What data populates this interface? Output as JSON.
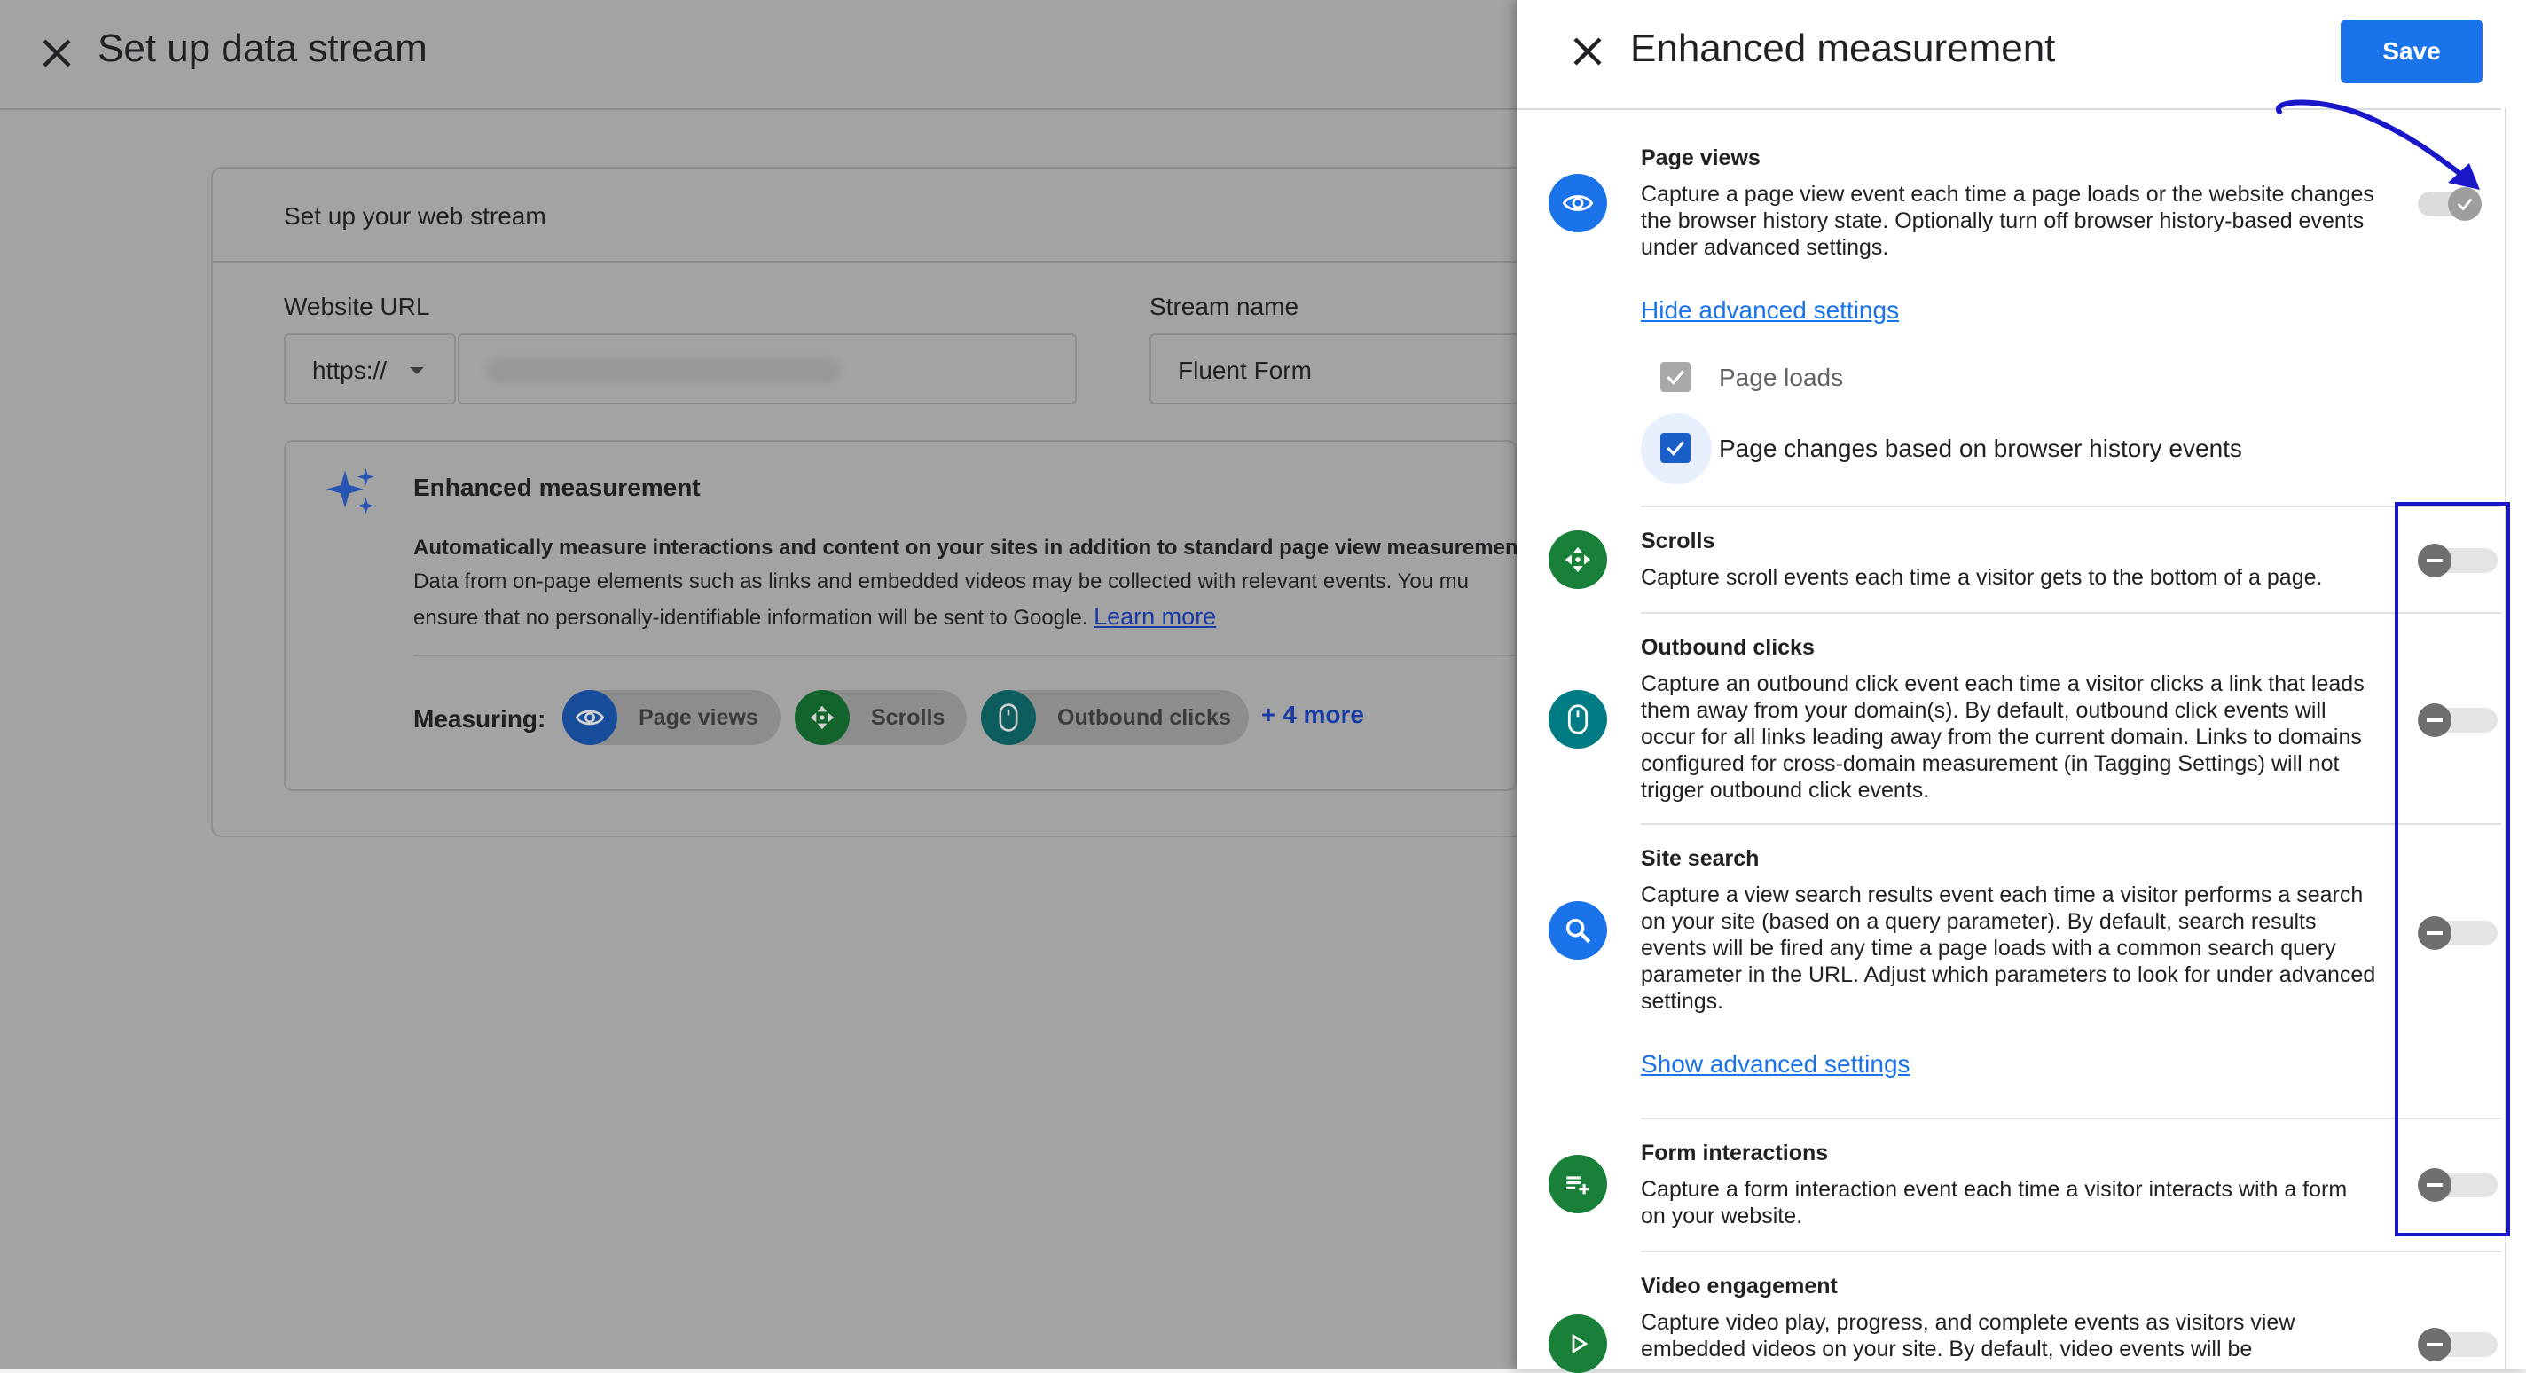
{
  "left": {
    "title": "Set up data stream",
    "card_title": "Set up your web stream",
    "website_url_label": "Website URL",
    "protocol_value": "https://",
    "stream_name_label": "Stream name",
    "stream_name_value": "Fluent Form",
    "enhanced": {
      "title": "Enhanced measurement",
      "desc_bold": "Automatically measure interactions and content on your sites in addition to standard page view measurement.",
      "desc_line2": "Data from on-page elements such as links and embedded videos may be collected with relevant events. You mu",
      "desc_line3": "ensure that no personally-identifiable information will be sent to Google.",
      "learn_more": "Learn more",
      "measuring_label": "Measuring:",
      "chips": [
        "Page views",
        "Scrolls",
        "Outbound clicks"
      ],
      "more": "+ 4 more"
    }
  },
  "panel": {
    "title": "Enhanced measurement",
    "save": "Save",
    "sections": [
      {
        "title": "Page views",
        "lines": [
          "Capture a page view event each time a page loads or the website changes",
          "the browser history state. Optionally turn off browser history-based events",
          "under advanced settings."
        ],
        "link": "Hide advanced settings",
        "options": [
          "Page loads",
          "Page changes based on browser history events"
        ]
      },
      {
        "title": "Scrolls",
        "lines": [
          "Capture scroll events each time a visitor gets to the bottom of a page."
        ]
      },
      {
        "title": "Outbound clicks",
        "lines": [
          "Capture an outbound click event each time a visitor clicks a link that leads",
          "them away from your domain(s). By default, outbound click events will",
          "occur for all links leading away from the current domain. Links to domains",
          "configured for cross-domain measurement (in Tagging Settings) will not",
          "trigger outbound click events."
        ]
      },
      {
        "title": "Site search",
        "lines": [
          "Capture a view search results event each time a visitor performs a search",
          "on your site (based on a query parameter). By default, search results",
          "events will be fired any time a page loads with a common search query",
          "parameter in the URL. Adjust which parameters to look for under advanced",
          "settings."
        ],
        "link": "Show advanced settings"
      },
      {
        "title": "Form interactions",
        "lines": [
          "Capture a form interaction event each time a visitor interacts with a form",
          "on your website."
        ]
      },
      {
        "title": "Video engagement",
        "lines": [
          "Capture video play, progress, and complete events as visitors view",
          "embedded videos on your site. By default, video events will be"
        ]
      }
    ]
  },
  "colors": {
    "primary_blue": "#1a73e8",
    "annotation_blue": "#1a17c9",
    "green": "#188038",
    "teal": "#007b83"
  }
}
